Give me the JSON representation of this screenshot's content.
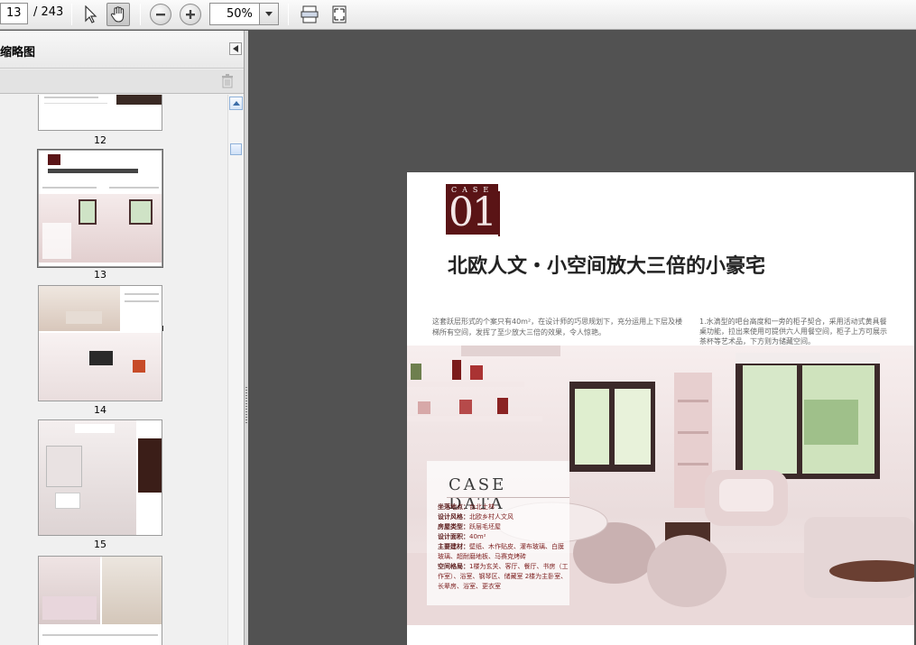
{
  "toolbar": {
    "page_current": "13",
    "page_total": "/ 243",
    "zoom_value": "50%"
  },
  "sidebar": {
    "title": "缩略图",
    "thumbnails": [
      {
        "label": "12"
      },
      {
        "label": "13"
      },
      {
        "label": "14"
      },
      {
        "label": "15"
      }
    ]
  },
  "document": {
    "case_word": "CASE",
    "case_number": "01",
    "title": "北欧人文・小空间放大三倍的小豪宅",
    "intro": "这套跃层形式的个案只有40m²，在设计师的巧思规划下，充分运用上下层及楼梯所有空间，发挥了至少放大三倍的效果，令人惊艳。",
    "note": "1.水滴型的吧台高度和一旁的柜子契合，采用活动式黄具餐桌功能，拉出来使用可提供六人用餐空间，柜子上方可展示茶杯等艺术品，下方则为储藏空间。",
    "case_data_heading": "CASE DATA",
    "case_data": [
      {
        "key": "坐落地点：",
        "value": "台北土林"
      },
      {
        "key": "设计风格：",
        "value": "北欧乡村人文风"
      },
      {
        "key": "房屋类型：",
        "value": "跃层毛坯屋"
      },
      {
        "key": "设计面积：",
        "value": "40m²"
      },
      {
        "key": "主要建材：",
        "value": "壁纸、木作贴皮、灌布玻璃、白膜玻璃、超耐磨地板、马赛克烤砖"
      },
      {
        "key": "空间格局：",
        "value": "1楼为玄关、客厅、餐厅、书房（工作室）、浴室、钢琴区、储藏室 2楼为主卧室、长辈房、浴室、更衣室"
      }
    ]
  },
  "colors": {
    "viewer_bg": "#525252",
    "brand_maroon": "#5a1416"
  }
}
